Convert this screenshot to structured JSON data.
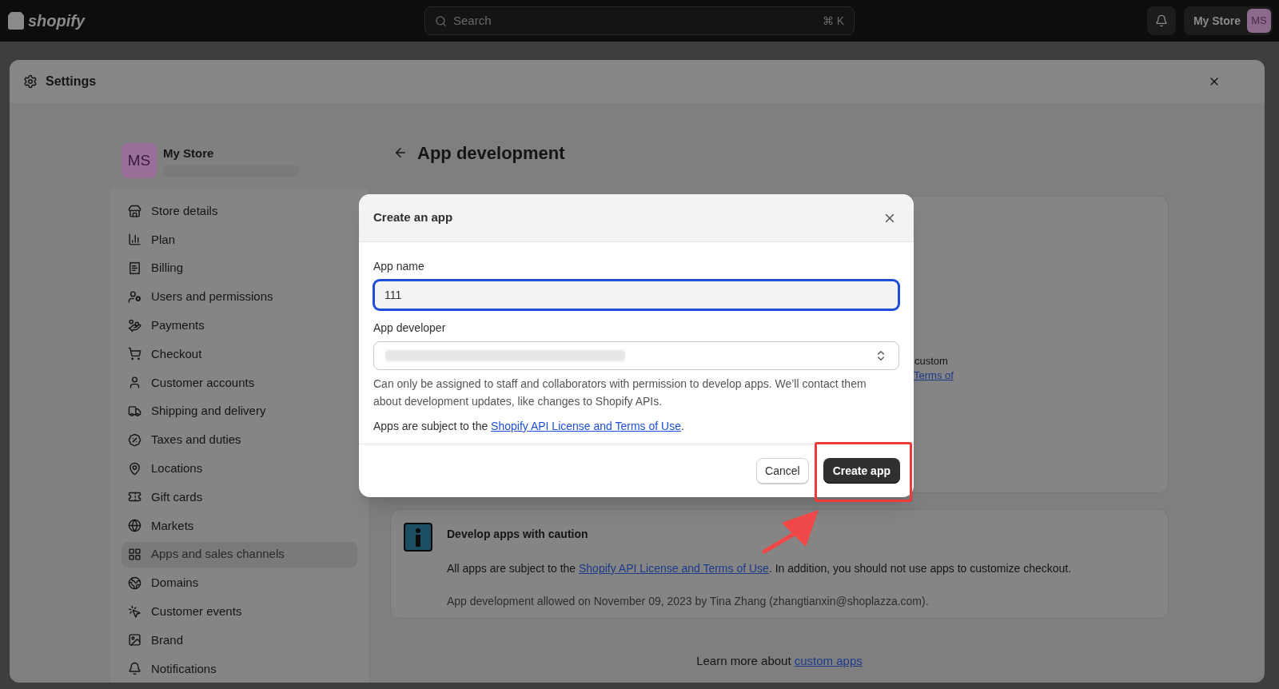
{
  "top_bar": {
    "logo": "shopify",
    "search": {
      "placeholder": "Search",
      "shortcut": "⌘ K"
    },
    "store": {
      "name": "My Store",
      "initials": "MS"
    }
  },
  "settings_window": {
    "title": "Settings"
  },
  "sidebar": {
    "store_name": "My Store",
    "initials": "MS",
    "items": [
      {
        "label": "Store details",
        "selected": false
      },
      {
        "label": "Plan",
        "selected": false
      },
      {
        "label": "Billing",
        "selected": false
      },
      {
        "label": "Users and permissions",
        "selected": false
      },
      {
        "label": "Payments",
        "selected": false
      },
      {
        "label": "Checkout",
        "selected": false
      },
      {
        "label": "Customer accounts",
        "selected": false
      },
      {
        "label": "Shipping and delivery",
        "selected": false
      },
      {
        "label": "Taxes and duties",
        "selected": false
      },
      {
        "label": "Locations",
        "selected": false
      },
      {
        "label": "Gift cards",
        "selected": false
      },
      {
        "label": "Markets",
        "selected": false
      },
      {
        "label": "Apps and sales channels",
        "selected": true
      },
      {
        "label": "Domains",
        "selected": false
      },
      {
        "label": "Customer events",
        "selected": false
      },
      {
        "label": "Brand",
        "selected": false
      },
      {
        "label": "Notifications",
        "selected": false
      }
    ]
  },
  "page": {
    "title": "App development",
    "hidden_card": {
      "text": "custom",
      "link": "Terms of"
    },
    "caution": {
      "title": "Develop apps with caution",
      "before": "All apps are subject to the ",
      "link": "Shopify API License and Terms of Use",
      "after": ". In addition, you should not use apps to customize checkout.",
      "note": "App development allowed on November 09, 2023 by Tina Zhang (zhangtianxin@shoplazza.com)."
    },
    "footer": {
      "text": "Learn more about ",
      "link": "custom apps"
    }
  },
  "dialog": {
    "title": "Create an app",
    "fields": [
      {
        "kind": "text",
        "label": "App name",
        "value": "111",
        "focused": true
      },
      {
        "kind": "select",
        "label": "App developer",
        "focused": false
      }
    ],
    "help": "Can only be assigned to staff and collaborators with permission to develop apps. We’ll contact them about development updates, like changes to Shopify APIs.",
    "terms": {
      "before": "Apps are subject to the ",
      "link": "Shopify API License and Terms of Use",
      "after": "."
    },
    "buttons": [
      {
        "kind": "secondary",
        "label": "Cancel"
      },
      {
        "kind": "primary",
        "label": "Create app"
      }
    ]
  }
}
